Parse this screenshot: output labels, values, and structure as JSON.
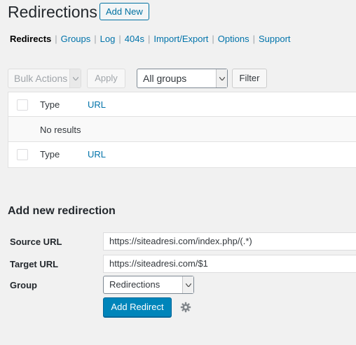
{
  "header": {
    "title": "Redirections",
    "add_new_label": "Add New"
  },
  "nav": {
    "items": [
      {
        "label": "Redirects",
        "current": true
      },
      {
        "label": "Groups",
        "current": false
      },
      {
        "label": "Log",
        "current": false
      },
      {
        "label": "404s",
        "current": false
      },
      {
        "label": "Import/Export",
        "current": false
      },
      {
        "label": "Options",
        "current": false
      },
      {
        "label": "Support",
        "current": false
      }
    ],
    "separator": "|"
  },
  "tablenav": {
    "bulk_actions_value": "Bulk Actions",
    "apply_label": "Apply",
    "group_filter_value": "All groups",
    "filter_label": "Filter"
  },
  "table": {
    "columns": [
      "Type",
      "URL"
    ],
    "empty_text": "No results"
  },
  "form": {
    "title": "Add new redirection",
    "source_label": "Source URL",
    "source_value": "https://siteadresi.com/index.php/(.*)",
    "target_label": "Target URL",
    "target_value": "https://siteadresi.com/$1",
    "group_label": "Group",
    "group_value": "Redirections",
    "submit_label": "Add Redirect",
    "settings_icon": "gear-icon"
  },
  "colors": {
    "link": "#0073aa",
    "primary_button": "#0085ba",
    "background": "#f1f1f1"
  }
}
